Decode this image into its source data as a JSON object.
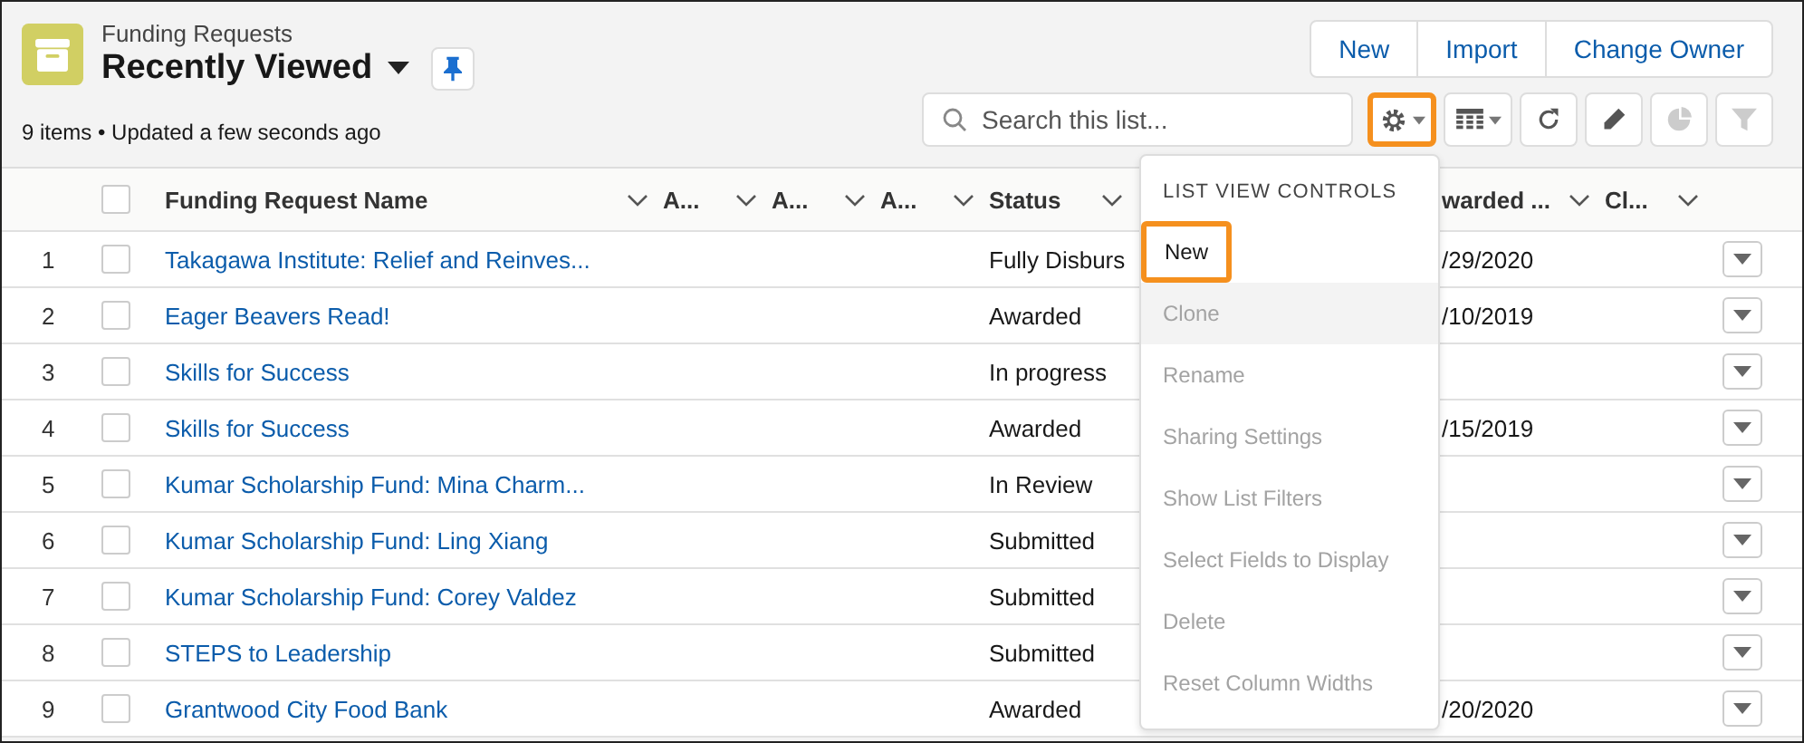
{
  "header": {
    "object_label": "Funding Requests",
    "list_view": "Recently Viewed",
    "status": "9 items • Updated a few seconds ago"
  },
  "actions": [
    "New",
    "Import",
    "Change Owner"
  ],
  "search": {
    "placeholder": "Search this list..."
  },
  "toolbar": [
    {
      "kind": "settings",
      "disabled": false,
      "highlighted": true
    },
    {
      "kind": "display",
      "disabled": false,
      "highlighted": false
    },
    {
      "kind": "refresh",
      "disabled": false,
      "highlighted": false
    },
    {
      "kind": "edit",
      "disabled": false,
      "highlighted": false
    },
    {
      "kind": "chart",
      "disabled": true,
      "highlighted": false
    },
    {
      "kind": "filter",
      "disabled": true,
      "highlighted": false
    }
  ],
  "table": {
    "select_all_checked": false,
    "columns": [
      "Funding Request Name",
      "A...",
      "A...",
      "A...",
      "Status",
      "warded ...",
      "Cl..."
    ],
    "rows": [
      {
        "number": "1",
        "name": "Takagawa Institute: Relief and Reinves...",
        "status": "Fully Disburs",
        "awarded": "/29/2020",
        "checked": false
      },
      {
        "number": "2",
        "name": "Eager Beavers Read!",
        "status": "Awarded",
        "awarded": "/10/2019",
        "checked": false
      },
      {
        "number": "3",
        "name": "Skills for Success",
        "status": "In progress",
        "checked": false
      },
      {
        "number": "4",
        "name": "Skills for Success",
        "status": "Awarded",
        "awarded": "/15/2019",
        "checked": false
      },
      {
        "number": "5",
        "name": "Kumar Scholarship Fund: Mina Charm...",
        "status": "In Review",
        "checked": false
      },
      {
        "number": "6",
        "name": "Kumar Scholarship Fund: Ling Xiang",
        "status": "Submitted",
        "checked": false
      },
      {
        "number": "7",
        "name": "Kumar Scholarship Fund: Corey Valdez",
        "status": "Submitted",
        "checked": false
      },
      {
        "number": "8",
        "name": "STEPS to Leadership",
        "status": "Submitted",
        "checked": false
      },
      {
        "number": "9",
        "name": "Grantwood City Food Bank",
        "status": "Awarded",
        "awarded": "/20/2020",
        "checked": false
      }
    ]
  },
  "menu": {
    "title": "LIST VIEW CONTROLS",
    "items": [
      {
        "label": "New",
        "disabled": false,
        "hovered": false,
        "highlighted": true
      },
      {
        "label": "Clone",
        "disabled": true,
        "hovered": true,
        "highlighted": false
      },
      {
        "label": "Rename",
        "disabled": true,
        "hovered": false,
        "highlighted": false
      },
      {
        "label": "Sharing Settings",
        "disabled": true,
        "hovered": false,
        "highlighted": false
      },
      {
        "label": "Show List Filters",
        "disabled": true,
        "hovered": false,
        "highlighted": false
      },
      {
        "label": "Select Fields to Display",
        "disabled": true,
        "hovered": false,
        "highlighted": false
      },
      {
        "label": "Delete",
        "disabled": true,
        "hovered": false,
        "highlighted": false
      },
      {
        "label": "Reset Column Widths",
        "disabled": true,
        "hovered": false,
        "highlighted": false
      }
    ]
  }
}
